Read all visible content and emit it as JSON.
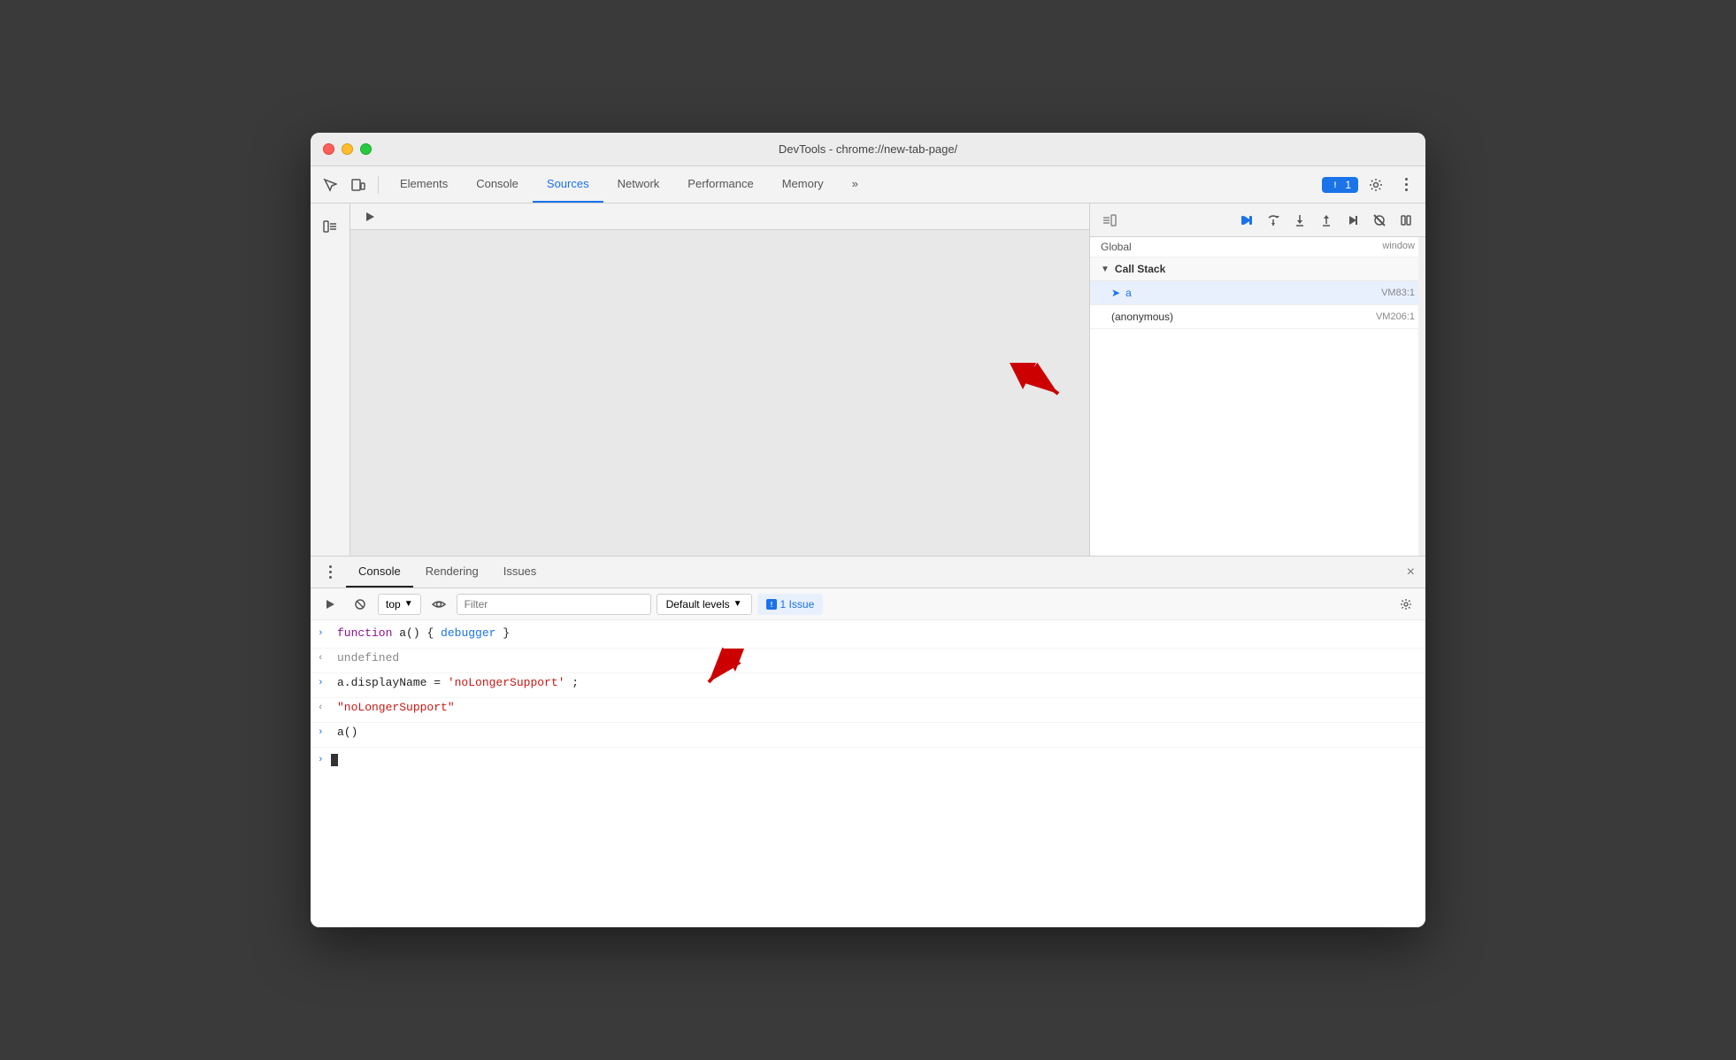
{
  "window": {
    "title": "DevTools - chrome://new-tab-page/"
  },
  "tabs": {
    "items": [
      {
        "label": "Elements",
        "active": false
      },
      {
        "label": "Console",
        "active": false
      },
      {
        "label": "Sources",
        "active": true
      },
      {
        "label": "Network",
        "active": false
      },
      {
        "label": "Performance",
        "active": false
      },
      {
        "label": "Memory",
        "active": false
      }
    ],
    "more_label": "»"
  },
  "toolbar_right": {
    "issues_count": "1",
    "settings_tooltip": "Settings",
    "more_tooltip": "More options"
  },
  "debugger_toolbar": {
    "buttons": [
      "resume",
      "step_over",
      "step_into",
      "step_out",
      "step",
      "deactivate",
      "pause_on_exceptions"
    ]
  },
  "debugger": {
    "global_label": "Global",
    "global_value": "window",
    "call_stack_label": "Call Stack",
    "call_stack_items": [
      {
        "name": "a",
        "file": "VM83:1",
        "active": true
      },
      {
        "name": "(anonymous)",
        "file": "VM206:1",
        "active": false
      }
    ]
  },
  "console_tabs": [
    {
      "label": "Console",
      "active": true
    },
    {
      "label": "Rendering",
      "active": false
    },
    {
      "label": "Issues",
      "active": false
    }
  ],
  "console_toolbar": {
    "filter_placeholder": "Filter",
    "levels_label": "Default levels",
    "issues_label": "1 Issue"
  },
  "console_lines": [
    {
      "type": "input",
      "parts": [
        {
          "text": "function",
          "class": "kw-function"
        },
        {
          "text": " a() { ",
          "class": "kw-punct"
        },
        {
          "text": "debugger",
          "class": "kw-debugger"
        },
        {
          "text": " }",
          "class": "kw-punct"
        }
      ]
    },
    {
      "type": "output",
      "parts": [
        {
          "text": "undefined",
          "class": "kw-undefined"
        }
      ]
    },
    {
      "type": "input",
      "parts": [
        {
          "text": "a.displayName = ",
          "class": "kw-identifier"
        },
        {
          "text": "'noLongerSupport'",
          "class": "kw-string"
        },
        {
          "text": ";",
          "class": "kw-punct"
        }
      ]
    },
    {
      "type": "output",
      "parts": [
        {
          "text": "\"noLongerSupport\"",
          "class": "kw-result"
        }
      ]
    },
    {
      "type": "input",
      "parts": [
        {
          "text": "a()",
          "class": "kw-call"
        }
      ]
    }
  ]
}
